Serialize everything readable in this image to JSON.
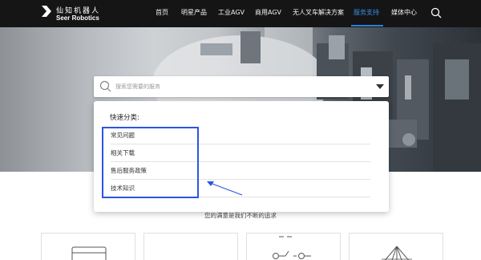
{
  "brand": {
    "name_cn": "仙知机器人",
    "name_en": "Seer Robotics"
  },
  "nav": {
    "items": [
      {
        "label": "首页"
      },
      {
        "label": "明星产品"
      },
      {
        "label": "工业AGV"
      },
      {
        "label": "商用AGV"
      },
      {
        "label": "无人叉车解决方案"
      },
      {
        "label": "服务支持",
        "active": true
      },
      {
        "label": "媒体中心"
      }
    ],
    "icons": {
      "search": "search-icon"
    }
  },
  "search": {
    "placeholder": "搜索您需要的服务"
  },
  "quick": {
    "title": "快速分类:",
    "items": [
      {
        "label": "常见问题"
      },
      {
        "label": "相关下载"
      },
      {
        "label": "售后服务政策"
      },
      {
        "label": "技术知识"
      }
    ]
  },
  "slogan": "您的满意是我们不断的追求",
  "colors": {
    "nav_bg": "#151515",
    "accent": "#3a8fe6",
    "annotation": "#2b55e0"
  }
}
